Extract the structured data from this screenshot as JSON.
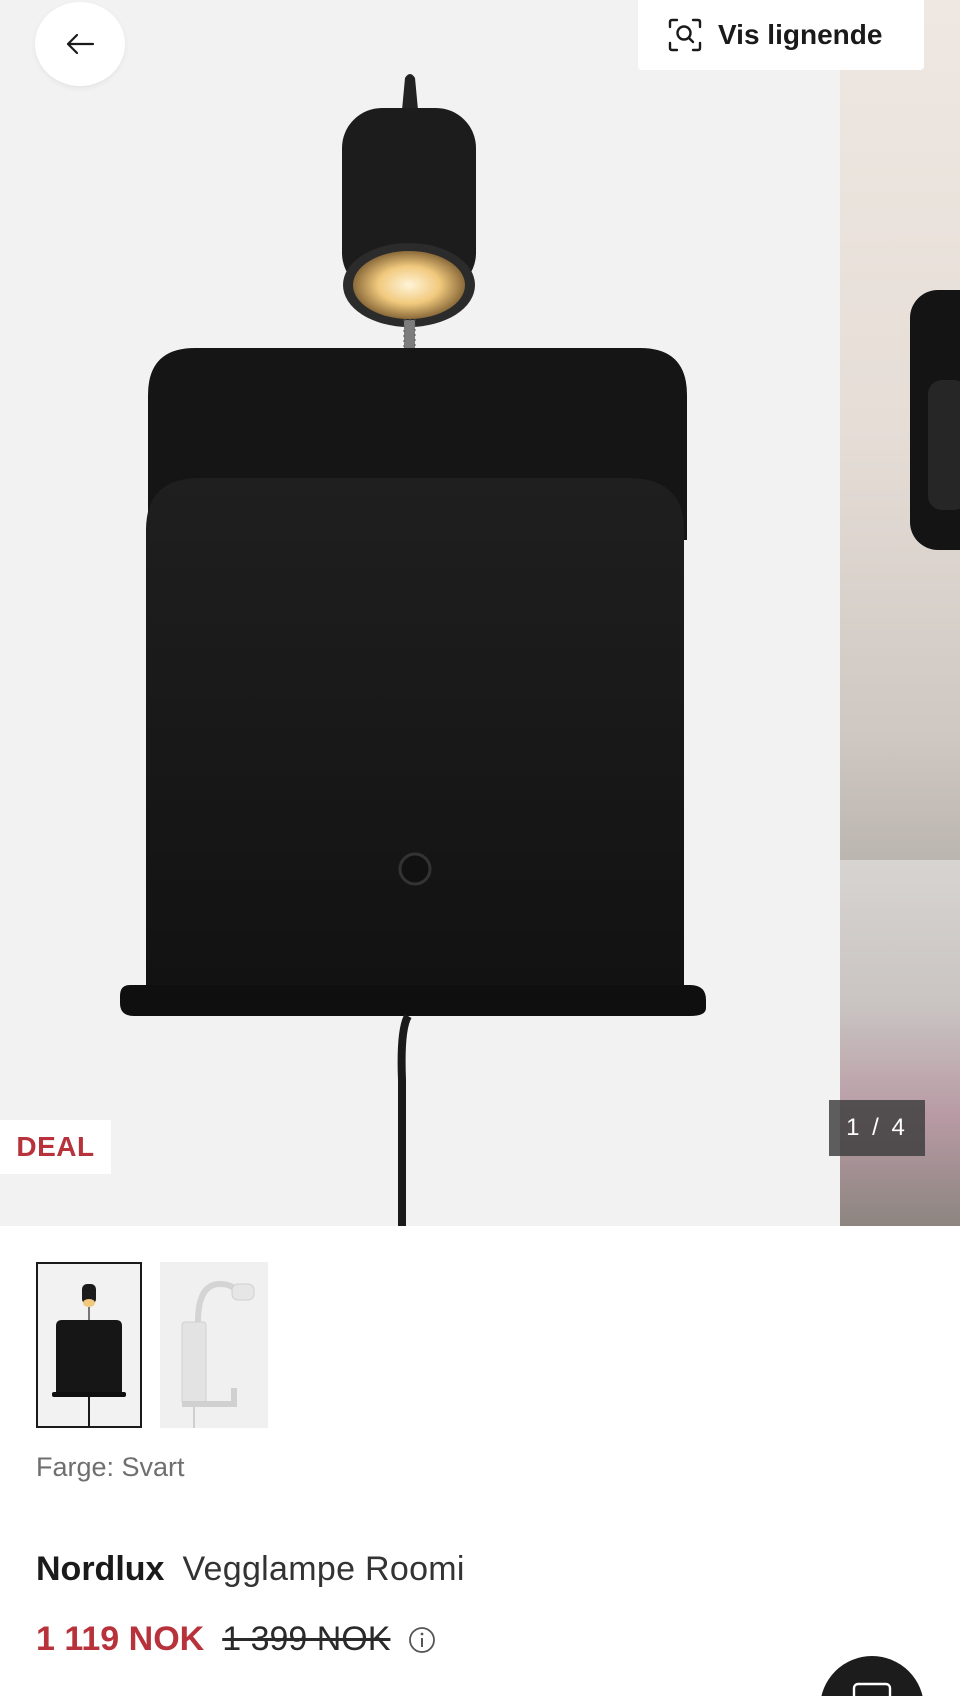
{
  "header": {
    "back_icon": "arrow-left-icon",
    "similar_icon": "visual-search-icon",
    "similar_label": "Vis lignende"
  },
  "gallery": {
    "badge": "DEAL",
    "counter": "1 / 4",
    "current_image": 1,
    "total_images": 4
  },
  "thumbnails": [
    {
      "name": "thumb-black-lamp",
      "selected": true
    },
    {
      "name": "thumb-white-lamp",
      "selected": false
    }
  ],
  "product": {
    "color_label": "Farge: Svart",
    "brand": "Nordlux",
    "name": "Vegglampe Roomi",
    "price_now": "1 119 NOK",
    "price_old": "1 399 NOK",
    "info_icon": "info-icon"
  },
  "colors": {
    "accent": "#b8323b",
    "text": "#1a1a1a",
    "muted": "#6f6f6f",
    "image_bg": "#f2f2f2"
  }
}
